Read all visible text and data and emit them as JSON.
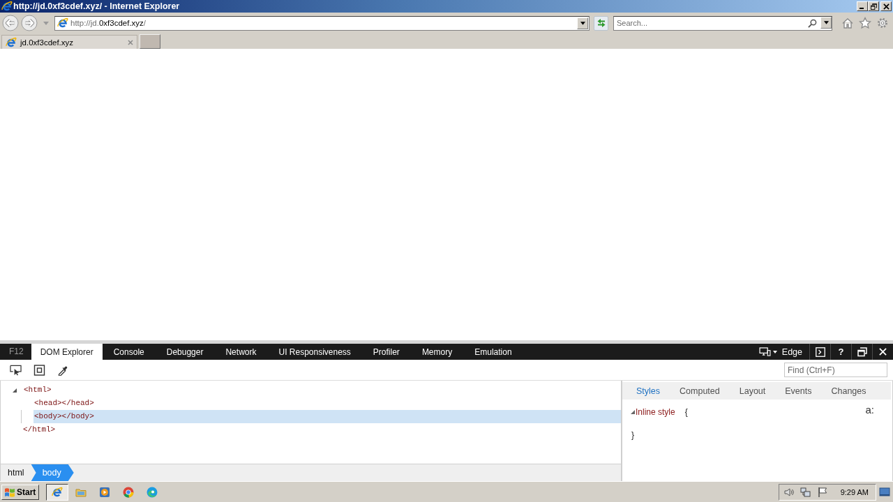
{
  "window": {
    "title": "http://jd.0xf3cdef.xyz/ - Internet Explorer"
  },
  "address_bar": {
    "scheme": "http://jd.",
    "domain": "0xf3cdef.xyz",
    "path": "/"
  },
  "search": {
    "placeholder": "Search..."
  },
  "tabs": [
    {
      "label": "jd.0xf3cdef.xyz",
      "selected": true
    }
  ],
  "devtools": {
    "shortcut": "F12",
    "tabs": [
      {
        "label": "DOM Explorer",
        "selected": true
      },
      {
        "label": "Console",
        "selected": false
      },
      {
        "label": "Debugger",
        "selected": false
      },
      {
        "label": "Network",
        "selected": false
      },
      {
        "label": "UI Responsiveness",
        "selected": false
      },
      {
        "label": "Profiler",
        "selected": false
      },
      {
        "label": "Memory",
        "selected": false
      },
      {
        "label": "Emulation",
        "selected": false
      }
    ],
    "document_mode": "Edge",
    "help": "?",
    "find": {
      "placeholder": "Find (Ctrl+F)"
    },
    "dom_tree": [
      {
        "open": "<html>",
        "close": "</html>",
        "expanded": true,
        "selected": false,
        "children": [
          {
            "open": "<head></head>",
            "selected": false
          },
          {
            "open": "<body></body>",
            "selected": true
          }
        ]
      }
    ],
    "breadcrumbs": [
      {
        "label": "html",
        "selected": false
      },
      {
        "label": "body",
        "selected": true
      }
    ],
    "style_tabs": [
      {
        "label": "Styles",
        "selected": true
      },
      {
        "label": "Computed",
        "selected": false
      },
      {
        "label": "Layout",
        "selected": false
      },
      {
        "label": "Events",
        "selected": false
      },
      {
        "label": "Changes",
        "selected": false
      }
    ],
    "styles": [
      {
        "selector": "Inline style",
        "expanded": true,
        "open_brace": "{",
        "close_brace": "}"
      }
    ],
    "pseudo_toggle": "a:"
  },
  "taskbar": {
    "start": "Start",
    "apps": [
      {
        "active": true
      },
      {
        "active": false
      },
      {
        "active": false
      },
      {
        "active": false
      },
      {
        "active": false
      }
    ],
    "clock": "9:29 AM"
  }
}
